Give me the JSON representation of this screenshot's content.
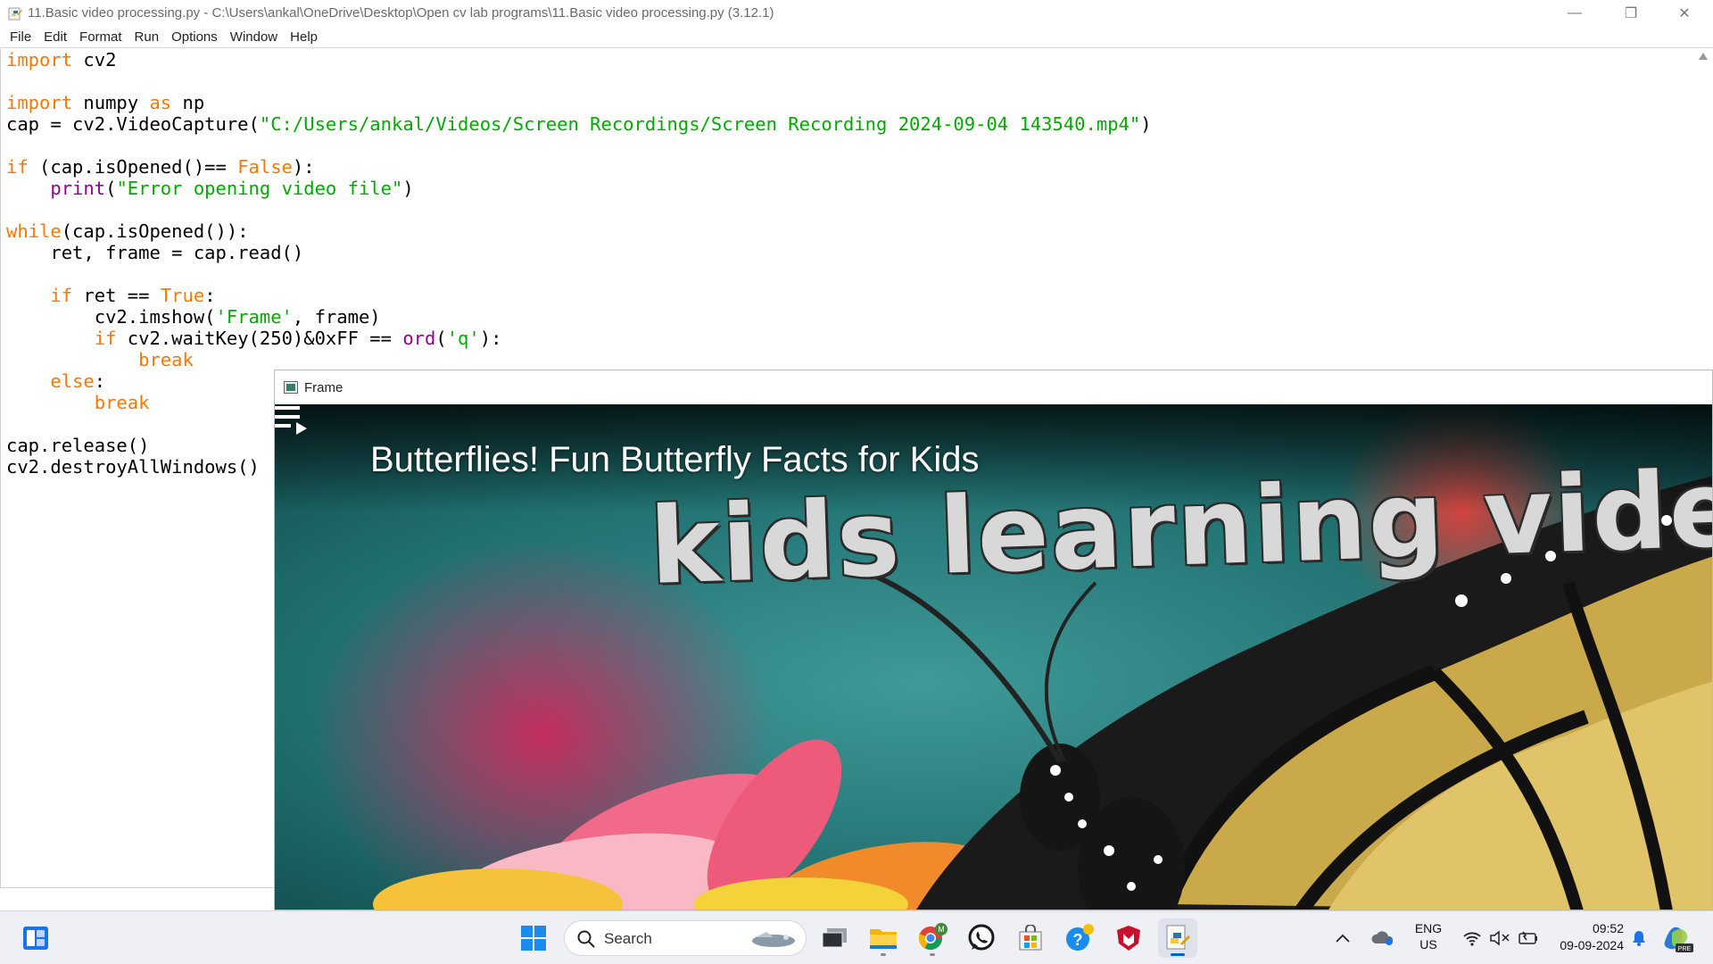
{
  "window": {
    "title": "11.Basic video processing.py - C:\\Users\\ankal\\OneDrive\\Desktop\\Open cv lab programs\\11.Basic video processing.py (3.12.1)",
    "minimize_glyph": "—",
    "maximize_glyph": "❐",
    "close_glyph": "✕"
  },
  "menu": {
    "items": [
      "File",
      "Edit",
      "Format",
      "Run",
      "Options",
      "Window",
      "Help"
    ]
  },
  "code_lines": [
    [
      {
        "t": "import",
        "c": "kw"
      },
      {
        "t": " cv2",
        "c": ""
      }
    ],
    [],
    [
      {
        "t": "import",
        "c": "kw"
      },
      {
        "t": " numpy ",
        "c": ""
      },
      {
        "t": "as",
        "c": "kw"
      },
      {
        "t": " np",
        "c": ""
      }
    ],
    [
      {
        "t": "cap = cv2.VideoCapture(",
        "c": ""
      },
      {
        "t": "\"C:/Users/ankal/Videos/Screen Recordings/Screen Recording 2024-09-04 143540.mp4\"",
        "c": "str"
      },
      {
        "t": ")",
        "c": ""
      }
    ],
    [],
    [
      {
        "t": "if",
        "c": "kw"
      },
      {
        "t": " (cap.isOpened()== ",
        "c": ""
      },
      {
        "t": "False",
        "c": "kw"
      },
      {
        "t": "):",
        "c": ""
      }
    ],
    [
      {
        "t": "    ",
        "c": ""
      },
      {
        "t": "print",
        "c": "bi"
      },
      {
        "t": "(",
        "c": ""
      },
      {
        "t": "\"Error opening video file\"",
        "c": "str"
      },
      {
        "t": ")",
        "c": ""
      }
    ],
    [],
    [
      {
        "t": "while",
        "c": "kw"
      },
      {
        "t": "(cap.isOpened()):",
        "c": ""
      }
    ],
    [
      {
        "t": "    ret, frame = cap.read()",
        "c": ""
      }
    ],
    [],
    [
      {
        "t": "    ",
        "c": ""
      },
      {
        "t": "if",
        "c": "kw"
      },
      {
        "t": " ret == ",
        "c": ""
      },
      {
        "t": "True",
        "c": "kw"
      },
      {
        "t": ":",
        "c": ""
      }
    ],
    [
      {
        "t": "        cv2.imshow(",
        "c": ""
      },
      {
        "t": "'Frame'",
        "c": "str"
      },
      {
        "t": ", frame)",
        "c": ""
      }
    ],
    [
      {
        "t": "        ",
        "c": ""
      },
      {
        "t": "if",
        "c": "kw"
      },
      {
        "t": " cv2.waitKey(250)&0xFF == ",
        "c": ""
      },
      {
        "t": "ord",
        "c": "bi"
      },
      {
        "t": "(",
        "c": ""
      },
      {
        "t": "'q'",
        "c": "str"
      },
      {
        "t": "):",
        "c": ""
      }
    ],
    [
      {
        "t": "            ",
        "c": ""
      },
      {
        "t": "break",
        "c": "kw"
      }
    ],
    [
      {
        "t": "    ",
        "c": ""
      },
      {
        "t": "else",
        "c": "kw"
      },
      {
        "t": ":",
        "c": ""
      }
    ],
    [
      {
        "t": "        ",
        "c": ""
      },
      {
        "t": "break",
        "c": "kw"
      }
    ],
    [],
    [
      {
        "t": "cap.release()",
        "c": ""
      }
    ],
    [
      {
        "t": "cv2.destroyAllWindows()",
        "c": ""
      }
    ]
  ],
  "frame_window": {
    "title": "Frame",
    "video_title": "Butterflies! Fun Butterfly Facts for Kids",
    "watermark": "kids learning videos pres"
  },
  "taskbar": {
    "search_label": "Search",
    "chrome_badge": "M",
    "lang_line1": "ENG",
    "lang_line2": "US",
    "time": "09:52",
    "date": "09-09-2024",
    "copilot_badge": "PRE"
  },
  "colors": {
    "keyword": "#ff7700",
    "builtin": "#900090",
    "string": "#00aa00",
    "accent": "#0067c0"
  }
}
